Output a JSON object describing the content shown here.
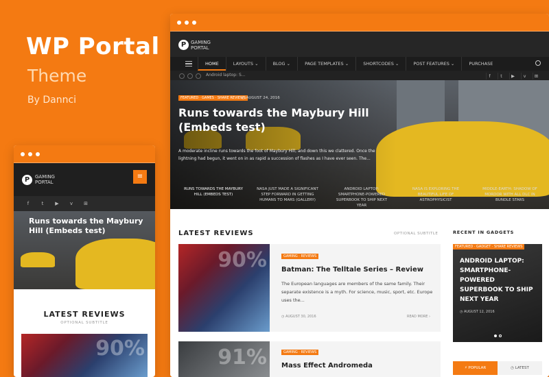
{
  "promo": {
    "title": "WP Portal",
    "subtitle": "Theme",
    "author": "By Dannci"
  },
  "brand": {
    "logo_letter": "P",
    "logo_line1": "GAMING",
    "logo_line2": "PORTAL",
    "accent": "#f47a12"
  },
  "nav": {
    "items": [
      "HOME",
      "LAYOUTS",
      "BLOG",
      "PAGE TEMPLATES",
      "SHORTCODES",
      "POST FEATURES",
      "PURCHASE"
    ],
    "active": "HOME"
  },
  "ticker": {
    "text": "Android laptop: S..."
  },
  "social": [
    "f",
    "t",
    "▶",
    "v",
    "⊞"
  ],
  "hero": {
    "categories": "FEATURED · GAMES · SHARE REVIEWS",
    "date": "AUGUST 24, 2016",
    "title": "Runs towards the Maybury Hill (Embeds test)",
    "excerpt": "A moderate incline runs towards the foot of Maybury Hill, and down this we clattered. Once the lightning had begun, it went on in as rapid a succession of flashes as I have ever seen. The...",
    "slides": [
      "RUNS TOWARDS THE MAYBURY HILL (EMBEDS TEST)",
      "NASA JUST MADE A SIGNIFICANT STEP FORWARD IN GETTING HUMANS TO MARS (GALLERY)",
      "ANDROID LAPTOP: SMARTPHONE-POWERED SUPERBOOK TO SHIP NEXT YEAR",
      "NASA IS EXPLORING THE BEAUTIFUL LIFE OF ASTROPHYSICIST",
      "MIDDLE-EARTH: SHADOW OF MORDOR WITH ALL DLC IN BUNDLE STARS"
    ]
  },
  "latest_reviews": {
    "title": "LATEST REVIEWS",
    "subtitle": "OPTIONAL SUBTITLE",
    "items": [
      {
        "tag": "GAMING · REVIEWS",
        "score": "90%",
        "title": "Batman: The Telltale Series – Review",
        "excerpt": "The European languages are members of the same family. Their separate existence is a myth. For science, music, sport, etc. Europe uses the...",
        "date": "AUGUST 30, 2016",
        "more": "READ MORE ›"
      },
      {
        "tag": "GAMING · REVIEWS",
        "score": "91%",
        "title": "Mass Effect Andromeda"
      }
    ]
  },
  "sidebar": {
    "title": "RECENT IN GADGETS",
    "card": {
      "tag": "FEATURED · GADGET · SHARE REVIEWS",
      "title": "ANDROID LAPTOP: SMARTPHONE-POWERED SUPERBOOK TO SHIP NEXT YEAR",
      "date": "AUGUST 12, 2016"
    },
    "tabs": [
      "⚡ POPULAR",
      "◷ LATEST"
    ]
  },
  "mobile": {
    "hero_title": "Runs towards the Maybury Hill (Embeds test)",
    "reviews_title": "LATEST REVIEWS",
    "reviews_subtitle": "OPTIONAL SUBTITLE",
    "score": "90%",
    "menu_icon": "≡"
  }
}
